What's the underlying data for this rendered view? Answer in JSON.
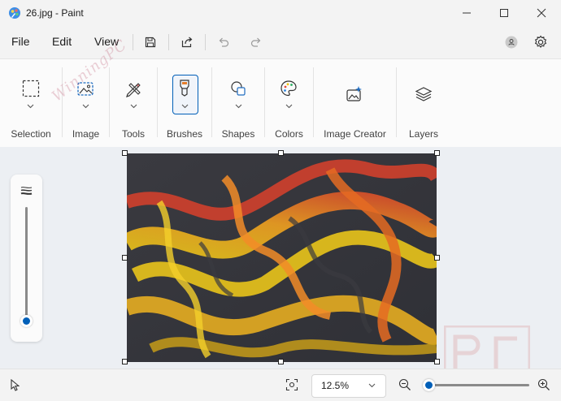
{
  "window": {
    "title": "26.jpg - Paint",
    "minimize_icon": "minimize-icon",
    "maximize_icon": "maximize-icon",
    "close_icon": "close-icon"
  },
  "menu": {
    "items": [
      "File",
      "Edit",
      "View"
    ],
    "save_icon": "save-icon",
    "share_icon": "share-icon",
    "undo_icon": "undo-icon",
    "redo_icon": "redo-icon",
    "account_icon": "account-icon",
    "settings_icon": "settings-icon"
  },
  "ribbon": {
    "groups": [
      {
        "label": "Selection",
        "icon": "selection-rectangle-icon"
      },
      {
        "label": "Image",
        "icon": "image-icon"
      },
      {
        "label": "Tools",
        "icon": "tools-icon"
      },
      {
        "label": "Brushes",
        "icon": "brush-icon"
      },
      {
        "label": "Shapes",
        "icon": "shapes-icon"
      },
      {
        "label": "Colors",
        "icon": "palette-icon"
      },
      {
        "label": "Image Creator",
        "icon": "image-creator-icon"
      },
      {
        "label": "Layers",
        "icon": "layers-icon"
      }
    ]
  },
  "brush_size_slider": {
    "level": 0.0
  },
  "watermark": {
    "text": "WinningPC"
  },
  "statusbar": {
    "zoom_value": "12.5%",
    "zoom_slider_level": 0.0
  },
  "colors": {
    "accent": "#005fb8",
    "ribbon_bg": "#fbfbfb",
    "canvas_bg": "#eceff3"
  }
}
